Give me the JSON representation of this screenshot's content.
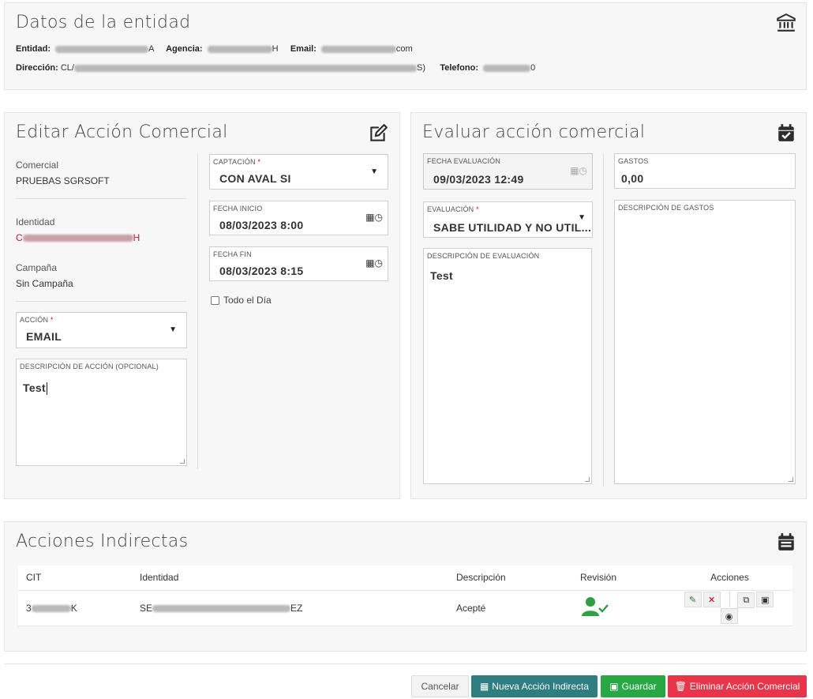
{
  "entity": {
    "title": "Datos de la entidad",
    "entidad_label": "Entidad:",
    "entidad_value_tail": "A",
    "agencia_label": "Agencia:",
    "agencia_value_tail": "H",
    "email_label": "Email:",
    "email_value_tail": "com",
    "direccion_label": "Dirección:",
    "direccion_value_head": "CL/",
    "direccion_value_tail": "S)",
    "telefono_label": "Telefono:",
    "telefono_value_tail": "0"
  },
  "edit": {
    "title": "Editar Acción Comercial",
    "comercial_label": "Comercial",
    "comercial_value": "PRUEBAS SGRSOFT",
    "identidad_label": "Identidad",
    "identidad_value_head": "C",
    "identidad_value_tail": "H",
    "campana_label": "Campaña",
    "campana_value": "Sin Campaña",
    "accion_label": "ACCIÓN",
    "accion_value": "EMAIL",
    "desc_label": "DESCRIPCIÓN DE ACCIÓN (OPCIONAL)",
    "desc_value": "Test",
    "captacion_label": "CAPTACIÓN",
    "captacion_value": "CON AVAL SI",
    "fecha_inicio_label": "FECHA INICIO",
    "fecha_inicio_value": "08/03/2023 8:00",
    "fecha_fin_label": "FECHA FIN",
    "fecha_fin_value": "08/03/2023 8:15",
    "todo_dia_label": "Todo el Día"
  },
  "evaluate": {
    "title": "Evaluar acción comercial",
    "fecha_eval_label": "FECHA EVALUACIÓN",
    "fecha_eval_value": "09/03/2023 12:49",
    "evaluacion_label": "EVALUACIÓN",
    "evaluacion_value": "SABE UTILIDAD Y NO UTIL...",
    "desc_eval_label": "DESCRIPCIÓN DE EVALUACIÓN",
    "desc_eval_value": "Test",
    "gastos_label": "GASTOS",
    "gastos_value": "0,00",
    "desc_gastos_label": "DESCRIPCIÓN DE GASTOS"
  },
  "indirect": {
    "title": "Acciones Indirectas",
    "columns": [
      "CIT",
      "Identidad",
      "Descripción",
      "Revisión",
      "Acciones"
    ],
    "rows": [
      {
        "cit_head": "3",
        "cit_tail": "K",
        "identidad_head": "SE",
        "identidad_tail": "EZ",
        "descripcion": "Acepté"
      }
    ]
  },
  "footer": {
    "cancel": "Cancelar",
    "new_indirect": "Nueva Acción Indirecta",
    "save": "Guardar",
    "delete": "Eliminar Acción Comercial"
  },
  "colors": {
    "teal": "#2e7d80",
    "green": "#28a745",
    "red": "#e8354a",
    "required": "#d0021b",
    "identity_red": "#b0223a",
    "check_green": "#2ea043"
  },
  "icons": [
    "bank-icon",
    "edit-icon",
    "calendar-check-icon",
    "calendar-icon",
    "user-check-icon"
  ]
}
